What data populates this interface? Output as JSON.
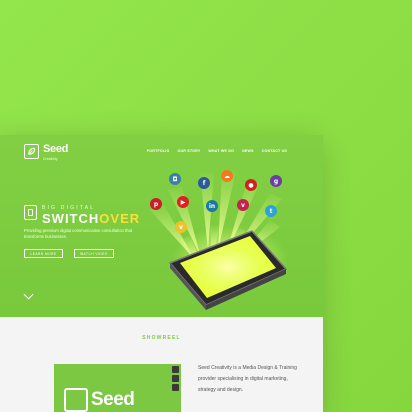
{
  "brand": {
    "name": "Seed",
    "sub": "Creativity"
  },
  "nav": [
    "PORTFOLIO",
    "OUR STORY",
    "WHAT WE DO",
    "NEWS",
    "CONTACT US"
  ],
  "hero": {
    "kicker": "BIG DIGITAL",
    "headline_a": "SWITCH",
    "headline_b": "OVER",
    "description": "Providing premium digital communication consultation that transforms businesses.",
    "btn_learn": "LEARN MORE",
    "btn_video": "WATCH VIDEO"
  },
  "social_icons": [
    "instagram-icon",
    "facebook-icon",
    "soundcloud-icon",
    "lastfm-icon",
    "googleplus-icon",
    "pinterest-icon",
    "youtube-icon",
    "linkedin-icon",
    "vimeo-icon",
    "twitter-icon",
    "vine-icon"
  ],
  "colors": {
    "accent": "#f7e13a",
    "brand_green": "#7fcc3c"
  },
  "showreel": {
    "title": "SHOWREEL"
  },
  "video": {
    "logo_word": "Seed"
  },
  "about": {
    "text": "Seed Creativity is a Media Design & Training provider specialising in digital marketing, strategy and design."
  }
}
